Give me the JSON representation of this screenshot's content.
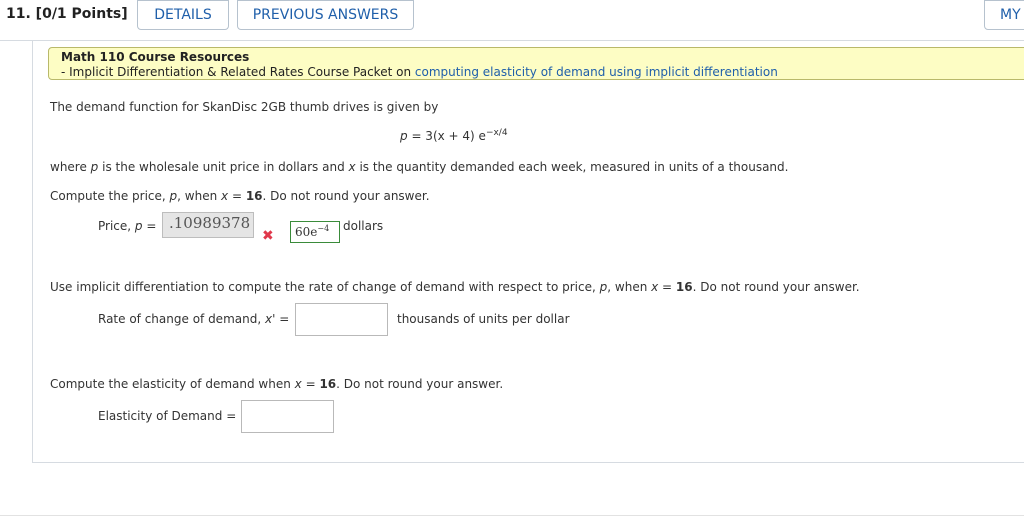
{
  "header": {
    "question_number": "11. [0/1 Points]",
    "tabs": [
      "DETAILS",
      "PREVIOUS ANSWERS",
      "MY"
    ]
  },
  "resources": {
    "title": "Math 110 Course Resources",
    "line_prefix": "- Implicit Differentiation & Related Rates Course Packet on ",
    "link_text": "computing elasticity of demand using implicit differentiation"
  },
  "problem": {
    "intro": "The demand function for SkanDisc 2GB thumb drives is given by",
    "equation": {
      "lhs": "p",
      "rhs": " = 3(x + 4) e",
      "exponent": "−x/4"
    },
    "where_1": "where ",
    "where_p": "p",
    "where_2": " is the wholesale unit price in dollars and ",
    "where_x": "x",
    "where_3": " is the quantity demanded each week, measured in units of a thousand."
  },
  "part1": {
    "q_prefix": "Compute the price, ",
    "q_var": "p",
    "q_mid": ", when ",
    "q_x": "x",
    "q_eq": " = ",
    "q_val": "16",
    "q_suffix": ". Do not round your answer.",
    "label_prefix": "Price, ",
    "label_var": "p",
    "label_suffix": " =",
    "answer": ".10989378",
    "correct_base": "60e",
    "correct_exp": "−4",
    "unit": "dollars"
  },
  "part2": {
    "q_prefix": "Use implicit differentiation to compute the rate of change of demand with respect to price, ",
    "q_var": "p",
    "q_mid": ", when ",
    "q_x": "x",
    "q_eq": " = ",
    "q_val": "16",
    "q_suffix": ". Do not round your answer.",
    "label_prefix": "Rate of change of demand, ",
    "label_var": "x'",
    "label_suffix": " =",
    "unit": "thousands of units per dollar"
  },
  "part3": {
    "q_prefix": "Compute the elasticity of demand when ",
    "q_x": "x",
    "q_eq": " = ",
    "q_val": "16",
    "q_suffix": ". Do not round your answer.",
    "label": "Elasticity of Demand ="
  }
}
